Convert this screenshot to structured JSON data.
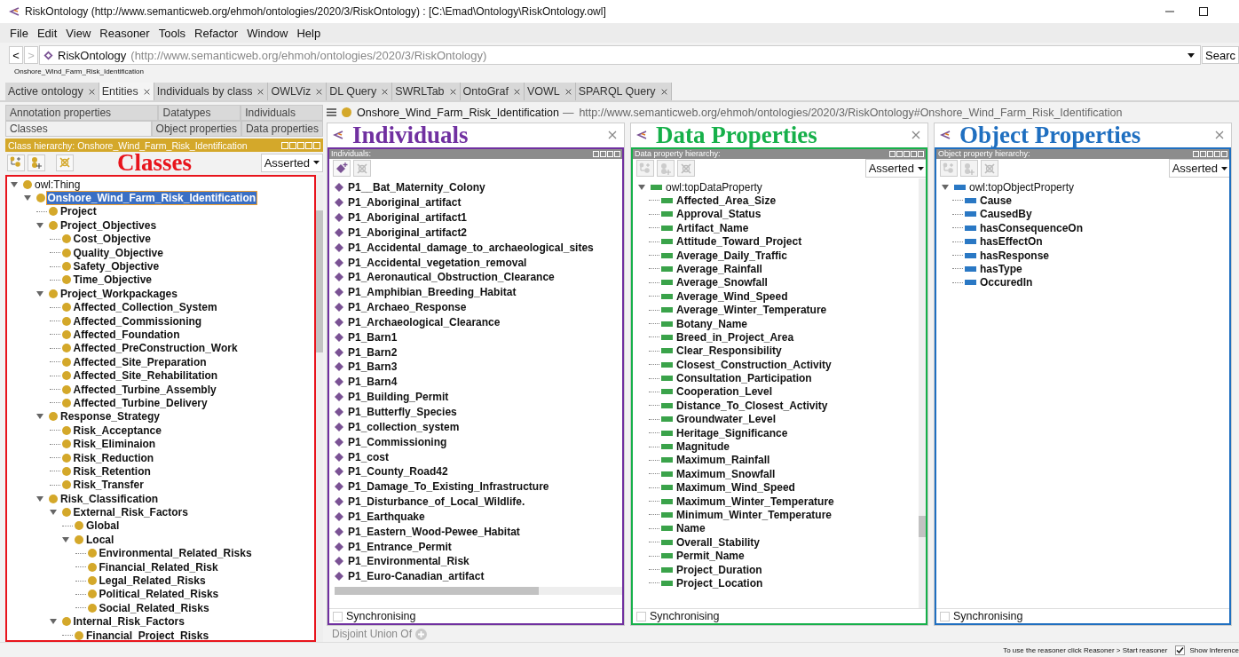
{
  "window": {
    "title": "RiskOntology (http://www.semanticweb.org/ehmoh/ontologies/2020/3/RiskOntology)  : [C:\\Emad\\Ontology\\RiskOntology.owl]"
  },
  "menu": [
    "File",
    "Edit",
    "View",
    "Reasoner",
    "Tools",
    "Refactor",
    "Window",
    "Help"
  ],
  "address": {
    "back": "<",
    "forward": ">",
    "name": "RiskOntology",
    "iri": "(http://www.semanticweb.org/ehmoh/ontologies/2020/3/RiskOntology)",
    "search": "Searc"
  },
  "breadcrumb": "Onshore_Wind_Farm_Risk_Identification",
  "tabs": [
    {
      "label": "Active ontology",
      "selected": false
    },
    {
      "label": "Entities",
      "selected": true
    },
    {
      "label": "Individuals by class",
      "selected": false
    },
    {
      "label": "OWLViz",
      "selected": false
    },
    {
      "label": "DL Query",
      "selected": false
    },
    {
      "label": "SWRLTab",
      "selected": false
    },
    {
      "label": "OntoGraf",
      "selected": false
    },
    {
      "label": "VOWL",
      "selected": false
    },
    {
      "label": "SPARQL Query",
      "selected": false
    }
  ],
  "entity_tabs": [
    [
      {
        "label": "Annotation properties",
        "selected": false
      },
      {
        "label": "Datatypes",
        "selected": false
      },
      {
        "label": "Individuals",
        "selected": false
      }
    ],
    [
      {
        "label": "Classes",
        "selected": true
      },
      {
        "label": "Object properties",
        "selected": false
      },
      {
        "label": "Data properties",
        "selected": false
      }
    ]
  ],
  "class_panel": {
    "header": "Class hierarchy: Onshore_Wind_Farm_Risk_Identification",
    "annotation": "Classes",
    "color": "#e8141c",
    "mode": "Asserted",
    "tree": {
      "label": "owl:Thing",
      "selected": false,
      "expanded": true,
      "children": [
        {
          "label": "Onshore_Wind_Farm_Risk_Identification",
          "selected": true,
          "expanded": true,
          "children": [
            {
              "label": "Project",
              "selected": false
            },
            {
              "label": "Project_Objectives",
              "selected": false,
              "expanded": true,
              "children": [
                {
                  "label": "Cost_Objective",
                  "selected": false
                },
                {
                  "label": "Quality_Objective",
                  "selected": false
                },
                {
                  "label": "Safety_Objective",
                  "selected": false
                },
                {
                  "label": "Time_Objective",
                  "selected": false
                }
              ]
            },
            {
              "label": "Project_Workpackages",
              "selected": false,
              "expanded": true,
              "children": [
                {
                  "label": "Affected_Collection_System",
                  "selected": false
                },
                {
                  "label": "Affected_Commissioning",
                  "selected": false
                },
                {
                  "label": "Affected_Foundation",
                  "selected": false
                },
                {
                  "label": "Affected_PreConstruction_Work",
                  "selected": false
                },
                {
                  "label": "Affected_Site_Preparation",
                  "selected": false
                },
                {
                  "label": "Affected_Site_Rehabilitation",
                  "selected": false
                },
                {
                  "label": "Affected_Turbine_Assembly",
                  "selected": false
                },
                {
                  "label": "Affected_Turbine_Delivery",
                  "selected": false
                }
              ]
            },
            {
              "label": "Response_Strategy",
              "selected": false,
              "expanded": true,
              "children": [
                {
                  "label": "Risk_Acceptance",
                  "selected": false
                },
                {
                  "label": "Risk_Eliminaion",
                  "selected": false
                },
                {
                  "label": "Risk_Reduction",
                  "selected": false
                },
                {
                  "label": "Risk_Retention",
                  "selected": false
                },
                {
                  "label": "Risk_Transfer",
                  "selected": false
                }
              ]
            },
            {
              "label": "Risk_Classification",
              "selected": false,
              "expanded": true,
              "children": [
                {
                  "label": "External_Risk_Factors",
                  "selected": false,
                  "expanded": true,
                  "children": [
                    {
                      "label": "Global",
                      "selected": false
                    },
                    {
                      "label": "Local",
                      "selected": false,
                      "expanded": true,
                      "children": [
                        {
                          "label": "Environmental_Related_Risks",
                          "selected": false
                        },
                        {
                          "label": "Financial_Related_Risk",
                          "selected": false
                        },
                        {
                          "label": "Legal_Related_Risks",
                          "selected": false
                        },
                        {
                          "label": "Political_Related_Risks",
                          "selected": false
                        },
                        {
                          "label": "Social_Related_Risks",
                          "selected": false
                        }
                      ]
                    }
                  ]
                },
                {
                  "label": "Internal_Risk_Factors",
                  "selected": false,
                  "expanded": true,
                  "children": [
                    {
                      "label": "Financial_Project_Risks",
                      "selected": false
                    }
                  ]
                }
              ]
            }
          ]
        }
      ]
    }
  },
  "entity_header": {
    "name": "Onshore_Wind_Farm_Risk_Identification",
    "separator": "—",
    "iri": "http://www.semanticweb.org/ehmoh/ontologies/2020/3/RiskOntology#Onshore_Wind_Farm_Risk_Identification"
  },
  "panels": [
    {
      "kind": "individuals",
      "annotation": "Individuals",
      "color": "#7030a0",
      "header": "Individuals:",
      "synchronising": "Synchronising",
      "synchronised": false,
      "items": [
        "P1__Bat_Maternity_Colony",
        "P1_Aboriginal_artifact",
        "P1_Aboriginal_artifact1",
        "P1_Aboriginal_artifact2",
        "P1_Accidental_damage_to_archaeological_sites",
        "P1_Accidental_vegetation_removal",
        "P1_Aeronautical_Obstruction_Clearance",
        "P1_Amphibian_Breeding_Habitat",
        "P1_Archaeo_Response",
        "P1_Archaeological_Clearance",
        "P1_Barn1",
        "P1_Barn2",
        "P1_Barn3",
        "P1_Barn4",
        "P1_Building_Permit",
        "P1_Butterfly_Species",
        "P1_collection_system",
        "P1_Commissioning",
        "P1_cost",
        "P1_County_Road42",
        "P1_Damage_To_Existing_Infrastructure",
        "P1_Disturbance_of_Local_Wildlife.",
        "P1_Earthquake",
        "P1_Eastern_Wood-Pewee_Habitat",
        "P1_Entrance_Permit",
        "P1_Environmental_Risk",
        "P1_Euro-Canadian_artifact"
      ]
    },
    {
      "kind": "data",
      "annotation": "Data Properties",
      "color": "#16b04a",
      "header": "Data property hierarchy:",
      "mode": "Asserted",
      "synchronising": "Synchronising",
      "synchronised": false,
      "root": "owl:topDataProperty",
      "items": [
        "Affected_Area_Size",
        "Approval_Status",
        "Artifact_Name",
        "Attitude_Toward_Project",
        "Average_Daily_Traffic",
        "Average_Rainfall",
        "Average_Snowfall",
        "Average_Wind_Speed",
        "Average_Winter_Temperature",
        "Botany_Name",
        "Breed_in_Project_Area",
        "Clear_Responsibility",
        "Closest_Construction_Activity",
        "Consultation_Participation",
        "Cooperation_Level",
        "Distance_To_Closest_Activity",
        "Groundwater_Level",
        "Heritage_Significance",
        "Magnitude",
        "Maximum_Rainfall",
        "Maximum_Snowfall",
        "Maximum_Wind_Speed",
        "Maximum_Winter_Temperature",
        "Minimum_Winter_Temperature",
        "Name",
        "Overall_Stability",
        "Permit_Name",
        "Project_Duration",
        "Project_Location"
      ]
    },
    {
      "kind": "object",
      "annotation": "Object Properties",
      "color": "#1f6fc0",
      "header": "Object property hierarchy:",
      "mode": "Asserted",
      "synchronising": "Synchronising",
      "synchronised": false,
      "root": "owl:topObjectProperty",
      "items": [
        "Cause",
        "CausedBy",
        "hasConsequenceOn",
        "hasEffectOn",
        "hasResponse",
        "hasType",
        "OccuredIn"
      ]
    }
  ],
  "disjoint_union": "Disjoint Union Of",
  "status_bar": {
    "message": "To use the reasoner click Reasoner > Start reasoner",
    "show_inferences": {
      "label": "Show Inference",
      "checked": true
    }
  }
}
